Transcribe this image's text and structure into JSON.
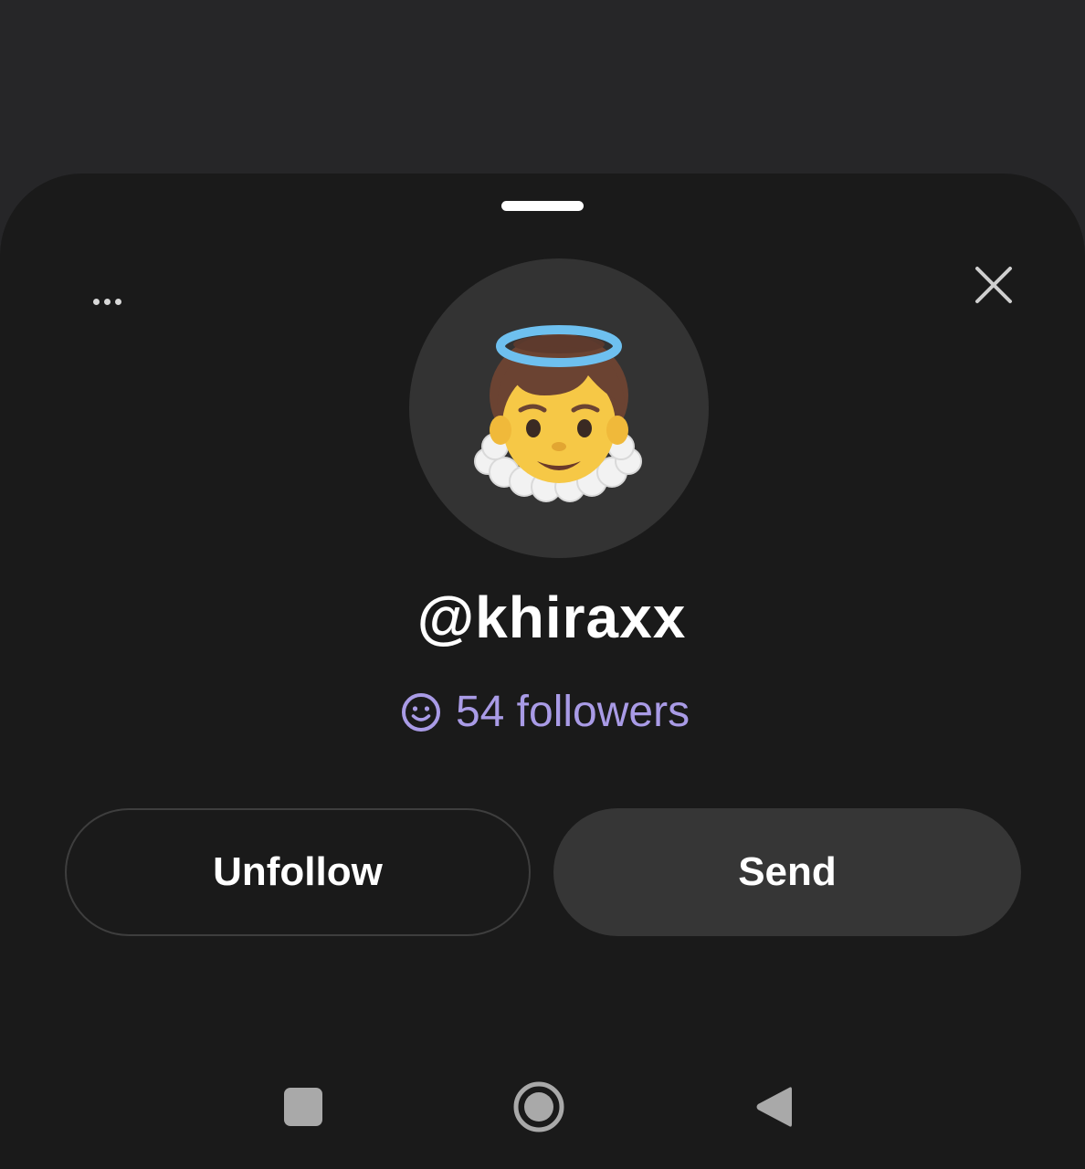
{
  "profile_sheet": {
    "username": "@khiraxx",
    "followers_text": "54 followers",
    "avatar_emoji": "baby-angel-emoji",
    "accent_color": "#a99be6"
  },
  "actions": {
    "unfollow_label": "Unfollow",
    "send_label": "Send"
  },
  "icons": {
    "more": "more-options-icon",
    "close": "close-icon",
    "followers": "smiley-face-icon"
  },
  "system_nav": {
    "recents": "recents-icon",
    "home": "home-icon",
    "back": "back-icon"
  }
}
